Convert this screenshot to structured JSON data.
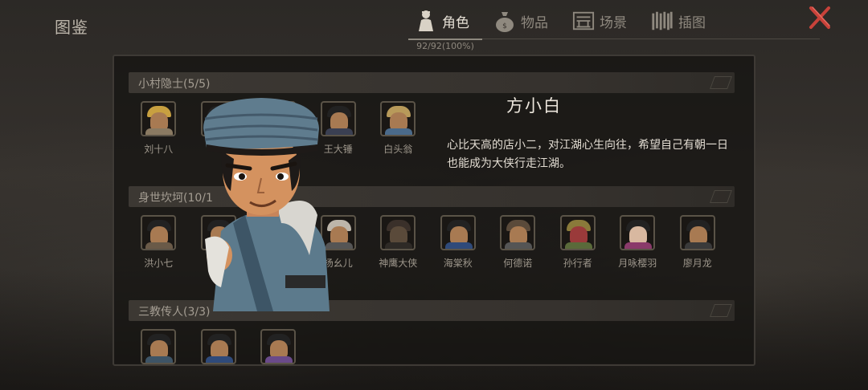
{
  "header": {
    "title": "图鉴",
    "tabs": [
      {
        "label": "角色",
        "icon": "character-icon",
        "active": true
      },
      {
        "label": "物品",
        "icon": "bag-icon",
        "active": false
      },
      {
        "label": "场景",
        "icon": "scene-icon",
        "active": false
      },
      {
        "label": "插图",
        "icon": "illustration-icon",
        "active": false
      }
    ],
    "progress": "92/92(100%)",
    "close_icon": "close-icon",
    "accent": "#c8423a"
  },
  "groups": [
    {
      "title": "小村隐士(5/5)",
      "characters": [
        "刘十八",
        "",
        "",
        "王大锤",
        "白头翁"
      ]
    },
    {
      "title": "身世坎坷(10/10)",
      "title_visible": "身世坎坷(10/1",
      "characters": [
        "洪小七",
        "",
        "",
        "杨幺儿",
        "神鹰大侠",
        "海棠秋",
        "何德诺",
        "孙行者",
        "月咏樱羽",
        "廖月龙"
      ]
    },
    {
      "title": "三教传人(3/3)",
      "characters": [
        "",
        "",
        ""
      ]
    }
  ],
  "detail": {
    "name": "方小白",
    "description": "心比天高的店小二，对江湖心生向往，希望自己有朝一日也能成为大侠行走江湖。"
  }
}
